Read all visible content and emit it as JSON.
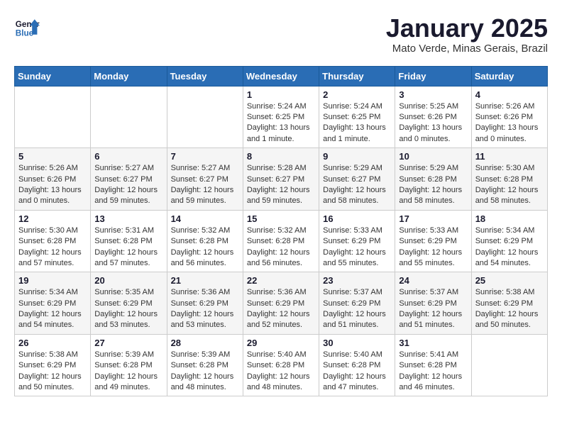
{
  "header": {
    "logo_line1": "General",
    "logo_line2": "Blue",
    "title": "January 2025",
    "subtitle": "Mato Verde, Minas Gerais, Brazil"
  },
  "weekdays": [
    "Sunday",
    "Monday",
    "Tuesday",
    "Wednesday",
    "Thursday",
    "Friday",
    "Saturday"
  ],
  "weeks": [
    [
      {
        "day": "",
        "info": ""
      },
      {
        "day": "",
        "info": ""
      },
      {
        "day": "",
        "info": ""
      },
      {
        "day": "1",
        "info": "Sunrise: 5:24 AM\nSunset: 6:25 PM\nDaylight: 13 hours\nand 1 minute."
      },
      {
        "day": "2",
        "info": "Sunrise: 5:24 AM\nSunset: 6:25 PM\nDaylight: 13 hours\nand 1 minute."
      },
      {
        "day": "3",
        "info": "Sunrise: 5:25 AM\nSunset: 6:26 PM\nDaylight: 13 hours\nand 0 minutes."
      },
      {
        "day": "4",
        "info": "Sunrise: 5:26 AM\nSunset: 6:26 PM\nDaylight: 13 hours\nand 0 minutes."
      }
    ],
    [
      {
        "day": "5",
        "info": "Sunrise: 5:26 AM\nSunset: 6:26 PM\nDaylight: 13 hours\nand 0 minutes."
      },
      {
        "day": "6",
        "info": "Sunrise: 5:27 AM\nSunset: 6:27 PM\nDaylight: 12 hours\nand 59 minutes."
      },
      {
        "day": "7",
        "info": "Sunrise: 5:27 AM\nSunset: 6:27 PM\nDaylight: 12 hours\nand 59 minutes."
      },
      {
        "day": "8",
        "info": "Sunrise: 5:28 AM\nSunset: 6:27 PM\nDaylight: 12 hours\nand 59 minutes."
      },
      {
        "day": "9",
        "info": "Sunrise: 5:29 AM\nSunset: 6:27 PM\nDaylight: 12 hours\nand 58 minutes."
      },
      {
        "day": "10",
        "info": "Sunrise: 5:29 AM\nSunset: 6:28 PM\nDaylight: 12 hours\nand 58 minutes."
      },
      {
        "day": "11",
        "info": "Sunrise: 5:30 AM\nSunset: 6:28 PM\nDaylight: 12 hours\nand 58 minutes."
      }
    ],
    [
      {
        "day": "12",
        "info": "Sunrise: 5:30 AM\nSunset: 6:28 PM\nDaylight: 12 hours\nand 57 minutes."
      },
      {
        "day": "13",
        "info": "Sunrise: 5:31 AM\nSunset: 6:28 PM\nDaylight: 12 hours\nand 57 minutes."
      },
      {
        "day": "14",
        "info": "Sunrise: 5:32 AM\nSunset: 6:28 PM\nDaylight: 12 hours\nand 56 minutes."
      },
      {
        "day": "15",
        "info": "Sunrise: 5:32 AM\nSunset: 6:28 PM\nDaylight: 12 hours\nand 56 minutes."
      },
      {
        "day": "16",
        "info": "Sunrise: 5:33 AM\nSunset: 6:29 PM\nDaylight: 12 hours\nand 55 minutes."
      },
      {
        "day": "17",
        "info": "Sunrise: 5:33 AM\nSunset: 6:29 PM\nDaylight: 12 hours\nand 55 minutes."
      },
      {
        "day": "18",
        "info": "Sunrise: 5:34 AM\nSunset: 6:29 PM\nDaylight: 12 hours\nand 54 minutes."
      }
    ],
    [
      {
        "day": "19",
        "info": "Sunrise: 5:34 AM\nSunset: 6:29 PM\nDaylight: 12 hours\nand 54 minutes."
      },
      {
        "day": "20",
        "info": "Sunrise: 5:35 AM\nSunset: 6:29 PM\nDaylight: 12 hours\nand 53 minutes."
      },
      {
        "day": "21",
        "info": "Sunrise: 5:36 AM\nSunset: 6:29 PM\nDaylight: 12 hours\nand 53 minutes."
      },
      {
        "day": "22",
        "info": "Sunrise: 5:36 AM\nSunset: 6:29 PM\nDaylight: 12 hours\nand 52 minutes."
      },
      {
        "day": "23",
        "info": "Sunrise: 5:37 AM\nSunset: 6:29 PM\nDaylight: 12 hours\nand 51 minutes."
      },
      {
        "day": "24",
        "info": "Sunrise: 5:37 AM\nSunset: 6:29 PM\nDaylight: 12 hours\nand 51 minutes."
      },
      {
        "day": "25",
        "info": "Sunrise: 5:38 AM\nSunset: 6:29 PM\nDaylight: 12 hours\nand 50 minutes."
      }
    ],
    [
      {
        "day": "26",
        "info": "Sunrise: 5:38 AM\nSunset: 6:29 PM\nDaylight: 12 hours\nand 50 minutes."
      },
      {
        "day": "27",
        "info": "Sunrise: 5:39 AM\nSunset: 6:28 PM\nDaylight: 12 hours\nand 49 minutes."
      },
      {
        "day": "28",
        "info": "Sunrise: 5:39 AM\nSunset: 6:28 PM\nDaylight: 12 hours\nand 48 minutes."
      },
      {
        "day": "29",
        "info": "Sunrise: 5:40 AM\nSunset: 6:28 PM\nDaylight: 12 hours\nand 48 minutes."
      },
      {
        "day": "30",
        "info": "Sunrise: 5:40 AM\nSunset: 6:28 PM\nDaylight: 12 hours\nand 47 minutes."
      },
      {
        "day": "31",
        "info": "Sunrise: 5:41 AM\nSunset: 6:28 PM\nDaylight: 12 hours\nand 46 minutes."
      },
      {
        "day": "",
        "info": ""
      }
    ]
  ]
}
